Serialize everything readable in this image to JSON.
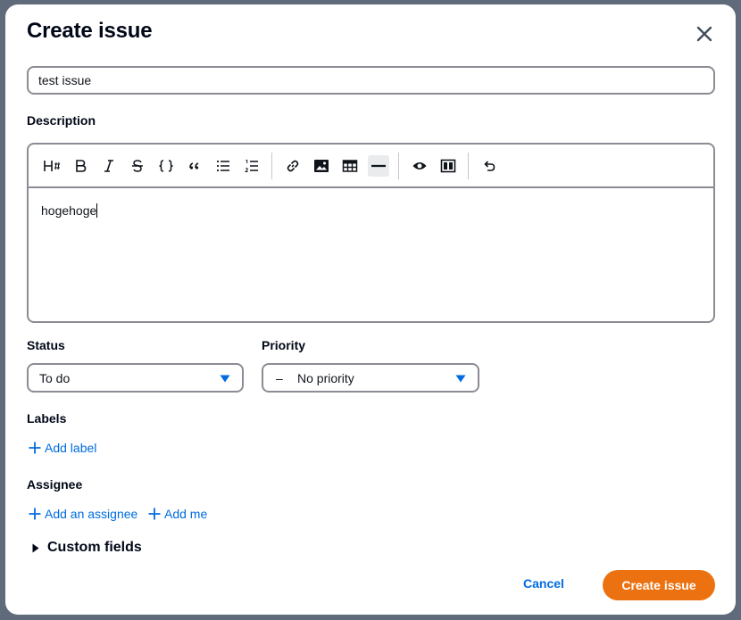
{
  "dialog": {
    "title": "Create issue",
    "close_icon": "close-icon"
  },
  "form": {
    "title_value": "test issue",
    "description_label": "Description",
    "description_text": "hogehoge",
    "toolbar": [
      {
        "name": "heading-icon"
      },
      {
        "name": "bold-icon"
      },
      {
        "name": "italic-icon"
      },
      {
        "name": "strikethrough-icon"
      },
      {
        "name": "code-icon"
      },
      {
        "name": "quote-icon"
      },
      {
        "name": "bulleted-list-icon"
      },
      {
        "name": "numbered-list-icon"
      },
      {
        "name": "link-icon"
      },
      {
        "name": "image-icon"
      },
      {
        "name": "table-icon"
      },
      {
        "name": "horizontal-rule-icon"
      },
      {
        "name": "preview-icon"
      },
      {
        "name": "split-view-icon"
      },
      {
        "name": "undo-icon"
      }
    ],
    "status_label": "Status",
    "status_value": "To do",
    "priority_label": "Priority",
    "priority_value": "No priority",
    "priority_prefix": "–",
    "labels_label": "Labels",
    "add_label": "Add label",
    "assignee_label": "Assignee",
    "add_assignee": "Add an assignee",
    "add_me": "Add me",
    "custom_fields": "Custom fields"
  },
  "actions": {
    "cancel": "Cancel",
    "create": "Create issue"
  },
  "colors": {
    "primary": "#ec7211",
    "link": "#006ce0",
    "border": "#8c8c94",
    "backdrop": "#5f6b7a"
  }
}
